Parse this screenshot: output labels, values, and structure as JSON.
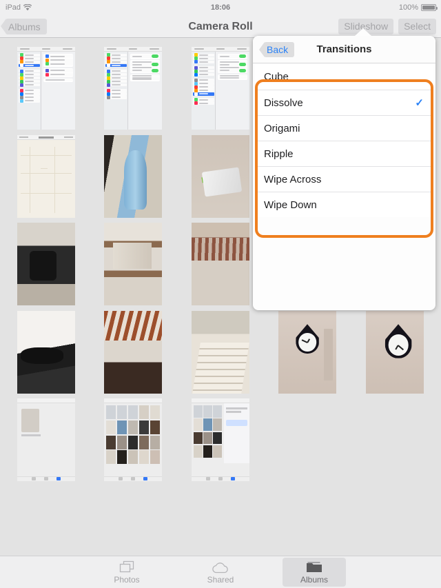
{
  "status_bar": {
    "carrier": "iPad",
    "wifi_icon": "wifi-icon",
    "time": "18:06",
    "battery_percent": "100%",
    "battery_icon": "battery-full-icon"
  },
  "nav_bar": {
    "back_label": "Albums",
    "title": "Camera Roll",
    "slideshow_label": "Slideshow",
    "select_label": "Select"
  },
  "popover": {
    "back_label": "Back",
    "title": "Transitions",
    "highlight_color": "#ef7f1f",
    "check_color": "#2b82f6",
    "selected": "Dissolve",
    "options": [
      {
        "label": "Cube",
        "checked": ""
      },
      {
        "label": "Dissolve",
        "checked": "✓"
      },
      {
        "label": "Origami",
        "checked": ""
      },
      {
        "label": "Ripple",
        "checked": ""
      },
      {
        "label": "Wipe Across",
        "checked": ""
      },
      {
        "label": "Wipe Down",
        "checked": ""
      }
    ]
  },
  "tab_bar": {
    "tabs": [
      {
        "label": "Photos",
        "icon": "photos-stack-icon",
        "active": false
      },
      {
        "label": "Shared",
        "icon": "cloud-icon",
        "active": false
      },
      {
        "label": "Albums",
        "icon": "albums-folder-icon",
        "active": true
      }
    ]
  },
  "grid": {
    "columns": 5,
    "rows": 5,
    "thumbnails": [
      {
        "name": "ios-settings-screenshot-1",
        "kind": "shot-settings"
      },
      {
        "name": "ios-settings-screenshot-2",
        "kind": "shot-settings"
      },
      {
        "name": "ios-settings-screenshot-3",
        "kind": "shot-settings"
      },
      {
        "name": "map-screenshot",
        "kind": "shot-map"
      },
      {
        "name": "water-dispenser-photo",
        "kind": "water"
      },
      {
        "name": "device-on-table-photo",
        "kind": "device"
      },
      {
        "name": "camera-on-desk-photo",
        "kind": "camera"
      },
      {
        "name": "shelf-photo",
        "kind": "shelf"
      },
      {
        "name": "wooden-ceiling-photo",
        "kind": "ceiling"
      },
      {
        "name": "white-car-photo",
        "kind": "car"
      },
      {
        "name": "patio-photo",
        "kind": "patio"
      },
      {
        "name": "staircase-photo",
        "kind": "stairs"
      },
      {
        "name": "wall-clock-photo-1",
        "kind": "clock-left"
      },
      {
        "name": "wall-clock-photo-2",
        "kind": "clock-right"
      },
      {
        "name": "album-screenshot",
        "kind": "shot-album"
      },
      {
        "name": "camera-roll-screenshot",
        "kind": "shot-grid"
      },
      {
        "name": "share-sheet-screenshot",
        "kind": "shot-share"
      }
    ]
  }
}
